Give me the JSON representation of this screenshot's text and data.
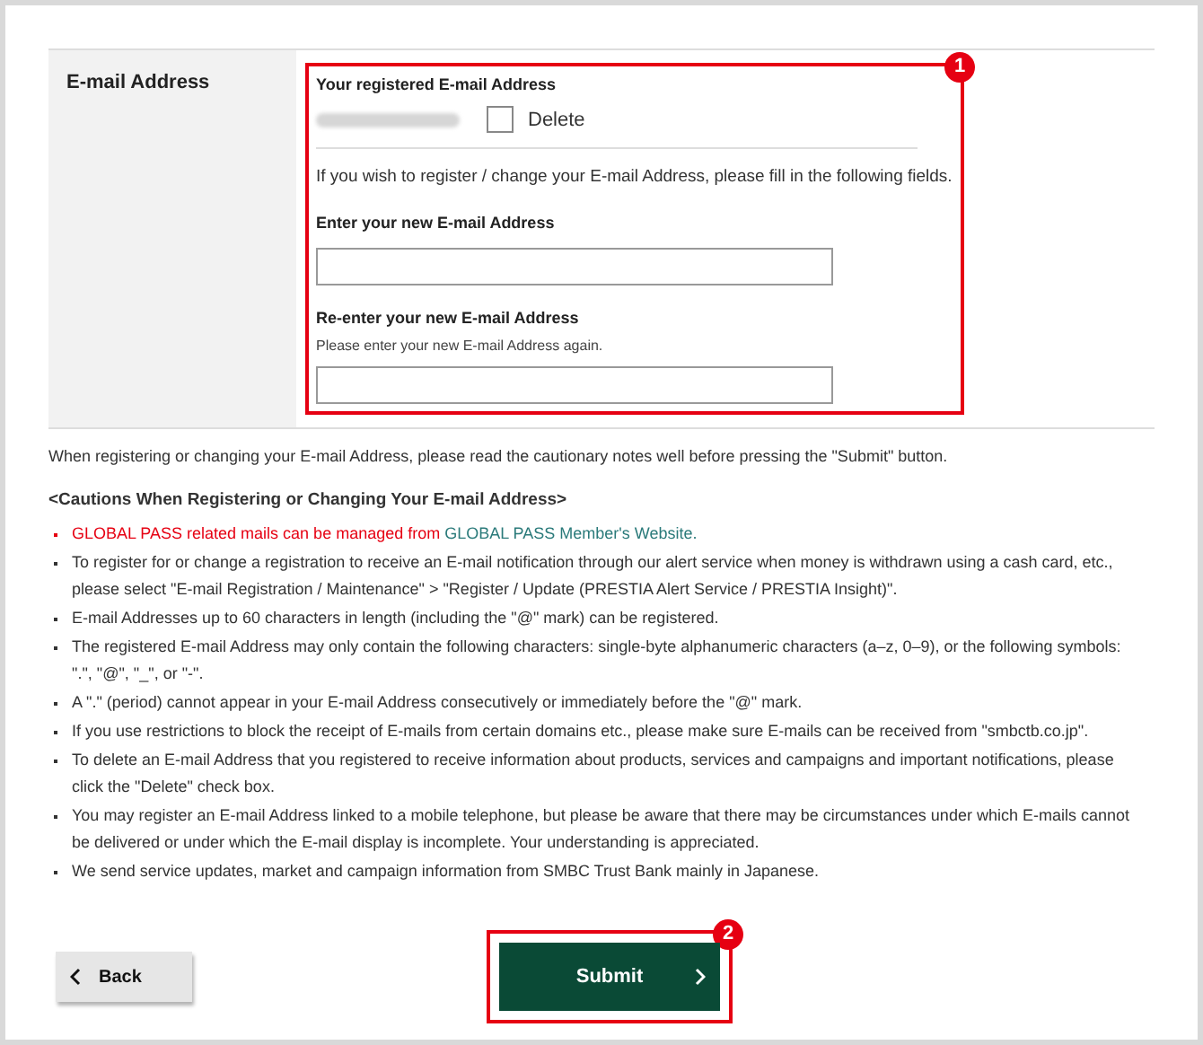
{
  "email_row": {
    "label": "E-mail Address",
    "annotation": "1",
    "registered_label": "Your registered E-mail Address",
    "delete": {
      "label": "Delete",
      "checked": false
    },
    "instruction": "If you wish to register / change your E-mail Address, please fill in the following fields.",
    "new_label": "Enter your new E-mail Address",
    "reenter_label": "Re-enter your new E-mail Address",
    "reenter_hint": "Please enter your new E-mail Address again."
  },
  "intro": "When registering or changing your E-mail Address, please read the cautionary notes well before pressing the \"Submit\" button.",
  "cautions_title": "<Cautions When Registering or Changing Your E-mail Address>",
  "cautions": [
    {
      "kind": "alert",
      "text": "GLOBAL PASS related mails can be managed from ",
      "link": "GLOBAL PASS Member's Website."
    },
    {
      "kind": "plain",
      "text": "To register for or change a registration to receive an E-mail notification through our alert service when money is withdrawn using a cash card, etc., please select \"E-mail Registration / Maintenance\" > \"Register / Update (PRESTIA Alert Service / PRESTIA Insight)\"."
    },
    {
      "kind": "plain",
      "text": "E-mail Addresses up to 60 characters in length (including the \"@\" mark) can be registered."
    },
    {
      "kind": "plain",
      "text": "The registered E-mail Address may only contain the following characters: single-byte alphanumeric characters (a–z, 0–9), or the following symbols: \".\", \"@\", \"_\", or \"-\"."
    },
    {
      "kind": "plain",
      "text": "A \".\" (period) cannot appear in your E-mail Address consecutively or immediately before the \"@\" mark."
    },
    {
      "kind": "plain",
      "text": "If you use restrictions to block the receipt of E-mails from certain domains etc., please make sure E-mails can be received from \"smbctb.co.jp\"."
    },
    {
      "kind": "plain",
      "text": "To delete an E-mail Address that you registered to receive information about products, services and campaigns and important notifications, please click the \"Delete\" check box."
    },
    {
      "kind": "plain",
      "text": "You may register an E-mail Address linked to a mobile telephone, but please be aware that there may be circumstances under which E-mails cannot be delivered or under which the E-mail display is incomplete. Your understanding is appreciated."
    },
    {
      "kind": "plain",
      "text": "We send service updates, market and campaign information from SMBC Trust Bank mainly in Japanese."
    }
  ],
  "buttons": {
    "back": "Back",
    "submit": "Submit",
    "submit_annotation": "2"
  }
}
